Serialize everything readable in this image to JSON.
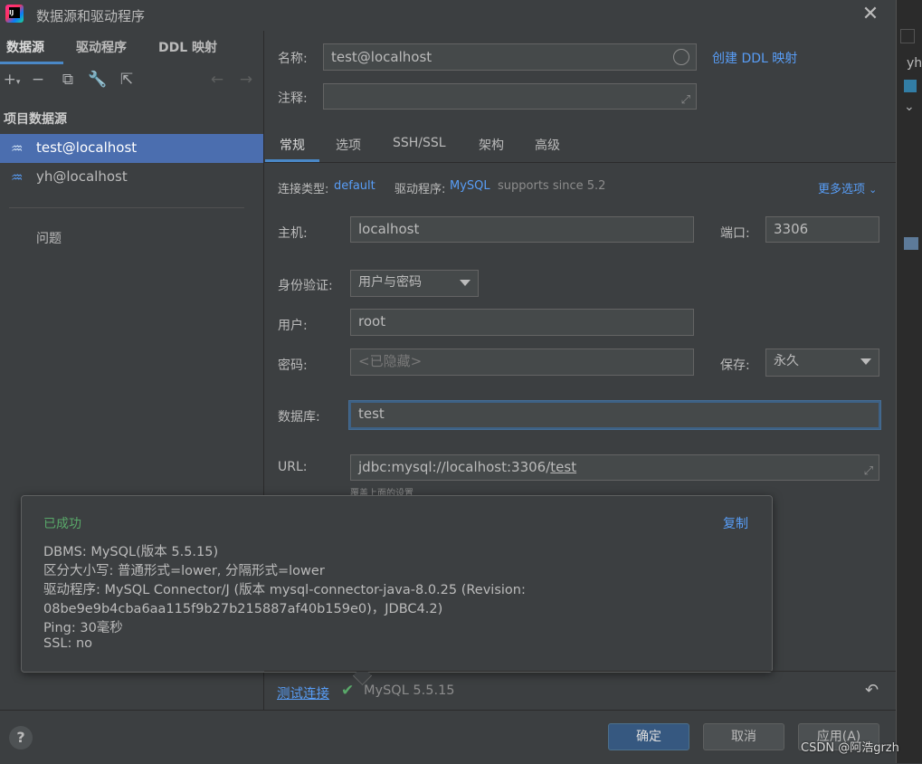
{
  "window": {
    "title": "数据源和驱动程序"
  },
  "right_strip": {
    "text": "yh"
  },
  "left": {
    "tabs": [
      {
        "label": "数据源"
      },
      {
        "label": "驱动程序"
      },
      {
        "label": "DDL 映射"
      }
    ],
    "section_header": "项目数据源",
    "datasources": [
      {
        "label": "test@localhost",
        "selected": true
      },
      {
        "label": "yh@localhost",
        "selected": false
      }
    ],
    "problems_label": "问题",
    "toolbar_icons": [
      "add-icon",
      "remove-icon",
      "duplicate-icon",
      "wrench-icon",
      "external-link-icon",
      "back-arrow-icon",
      "forward-arrow-icon"
    ]
  },
  "form": {
    "name_label": "名称:",
    "name_value": "test@localhost",
    "create_ddl_link": "创建 DDL 映射",
    "comment_label": "注释:",
    "comment_value": "",
    "tabs": [
      {
        "label": "常规"
      },
      {
        "label": "选项"
      },
      {
        "label": "SSH/SSL"
      },
      {
        "label": "架构"
      },
      {
        "label": "高级"
      }
    ],
    "conn_type_label": "连接类型:",
    "conn_type_value": "default",
    "driver_label": "驱动程序:",
    "driver_value": "MySQL",
    "driver_note": "supports since 5.2",
    "more_options": "更多选项",
    "host_label": "主机:",
    "host_value": "localhost",
    "port_label": "端口:",
    "port_value": "3306",
    "auth_label": "身份验证:",
    "auth_value": "用户与密码",
    "user_label": "用户:",
    "user_value": "root",
    "password_label": "密码:",
    "password_placeholder": "<已隐藏>",
    "save_label": "保存:",
    "save_value": "永久",
    "database_label": "数据库:",
    "database_value": "test",
    "url_label": "URL:",
    "url_prefix": "jdbc:mysql://localhost:3306/",
    "url_db": "test",
    "url_hint": "覆盖上面的设置"
  },
  "popup": {
    "status": "已成功",
    "copy_label": "复制",
    "lines": [
      "DBMS: MySQL(版本 5.5.15)",
      "区分大小写: 普通形式=lower, 分隔形式=lower",
      "驱动程序: MySQL Connector/J (版本 mysql-connector-java-8.0.25 (Revision:",
      "08be9e9b4cba6aa115f9b27b215887af40b159e0)，JDBC4.2)",
      "Ping: 30毫秒",
      "SSL: no"
    ]
  },
  "test_connection": {
    "label": "测试连接",
    "result": "MySQL 5.5.15"
  },
  "footer": {
    "help": "?",
    "ok": "确定",
    "cancel": "取消",
    "apply": "应用(A)"
  },
  "watermark": "CSDN @阿浩grzh",
  "colors": {
    "accent": "#4a88c7",
    "selection": "#4b6eaf",
    "link": "#589df6",
    "success": "#59a869",
    "primary_button": "#365880"
  }
}
